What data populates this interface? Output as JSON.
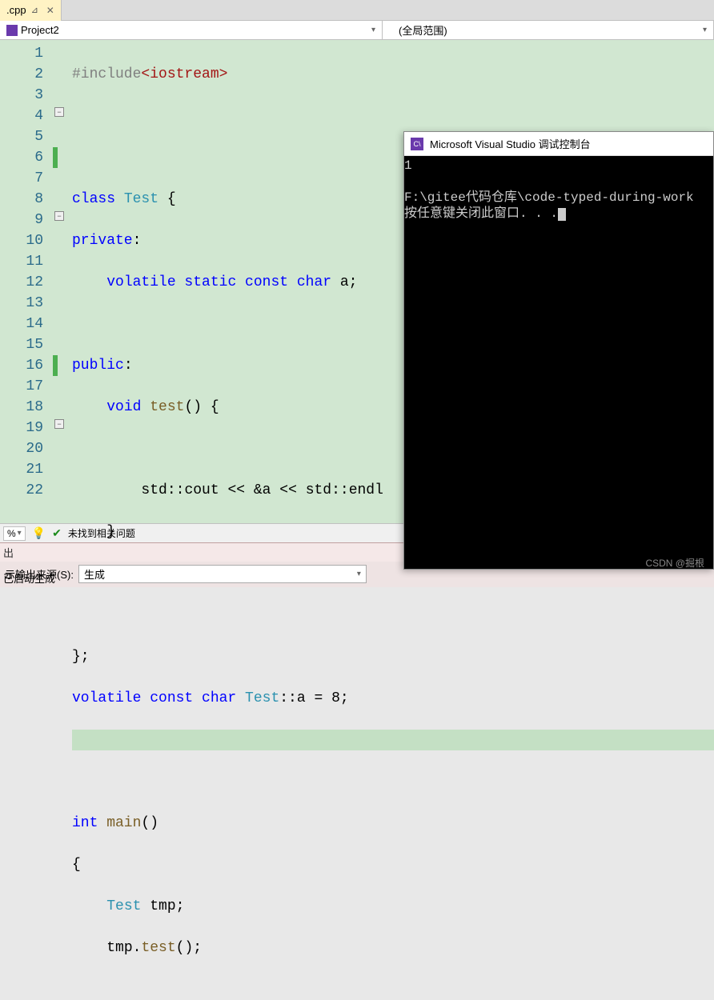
{
  "tab": {
    "filename": ".cpp",
    "pin": "📌"
  },
  "dropdowns": {
    "left": "Project2",
    "right": "(全局范围)"
  },
  "line_numbers": [
    "1",
    "2",
    "3",
    "4",
    "5",
    "6",
    "7",
    "8",
    "9",
    "10",
    "11",
    "12",
    "13",
    "14",
    "15",
    "16",
    "17",
    "18",
    "19",
    "20",
    "21",
    "22"
  ],
  "code": {
    "l1": {
      "preproc": "#include",
      "inc": "<iostream>"
    },
    "l4": {
      "kw1": "class",
      "cls": "Test",
      "brace": " {"
    },
    "l5": {
      "kw": "private",
      "colon": ":"
    },
    "l6": {
      "kw": "volatile static const char",
      "var": " a;"
    },
    "l8": {
      "kw": "public",
      "colon": ":"
    },
    "l9": {
      "kw": "void",
      "fn": " test",
      "rest": "() {"
    },
    "l11": {
      "std": "std",
      "op1": "::",
      "cout": "cout",
      "op2": " << &a << ",
      "std2": "std",
      "op3": "::",
      "endl": "endl"
    },
    "l12": {
      "brace": "}"
    },
    "l15": {
      "brace": "};"
    },
    "l16": {
      "kw": "volatile const char",
      "cls": " Test",
      "op": "::",
      "var": "a = 8;"
    },
    "l19": {
      "kw": "int",
      "fn": " main",
      "rest": "()"
    },
    "l20": {
      "brace": "{"
    },
    "l21": {
      "cls": "Test",
      "var": " tmp;"
    },
    "l22": {
      "var": "tmp.",
      "fn": "test",
      "rest": "();"
    }
  },
  "status": {
    "pct": "%",
    "no_issues": "未找到相关问题"
  },
  "output": {
    "title": "出",
    "source_label": "示输出来源(S):",
    "source_value": "生成",
    "status": "已启动生成"
  },
  "console": {
    "title": "Microsoft Visual Studio 调试控制台",
    "line1": "1",
    "line2": "",
    "line3": "F:\\gitee代码仓库\\code-typed-during-work",
    "line4": "按任意键关闭此窗口. . ."
  },
  "watermark": "CSDN @掘根"
}
